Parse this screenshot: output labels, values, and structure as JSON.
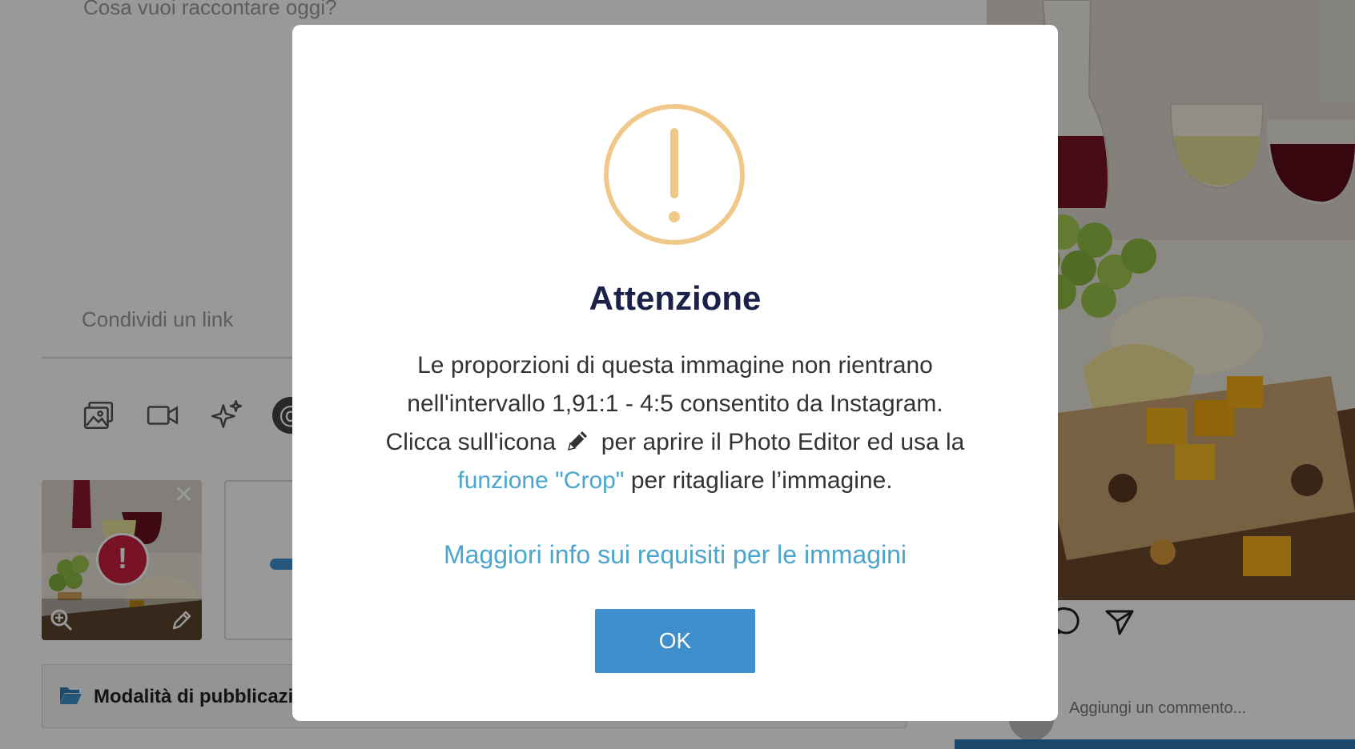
{
  "composer": {
    "post_placeholder": "Cosa vuoi raccontare oggi?",
    "link_placeholder": "Condividi un link",
    "toolbar": {
      "icons": [
        "image-icon",
        "video-icon",
        "sparkles-icon",
        "mention-icon"
      ],
      "mention_glyph": "@"
    },
    "media": {
      "error_glyph": "!",
      "close_glyph": "✕"
    },
    "publish_mode_label": "Modalità di pubblicazione"
  },
  "preview": {
    "comment_placeholder": "Aggiungi un commento..."
  },
  "modal": {
    "title": "Attenzione",
    "body_line1": "Le proporzioni di questa immagine non rientrano",
    "body_line2": "nell'intervallo 1,91:1 - 4:5 consentito da Instagram.",
    "body_line3_before": "Clicca sull'icona",
    "body_line3_after": "per aprire il Photo Editor ed usa la",
    "crop_link": "funzione \"Crop\"",
    "body_line4_after": "per ritagliare l’immagine.",
    "info_link": "Maggiori info sui requisiti per le immagini",
    "ok_label": "OK"
  },
  "colors": {
    "warning": "#f0c98a",
    "title": "#1b2148",
    "link": "#4ba5cc",
    "button": "#3f8fcd",
    "error_badge": "#c8203f"
  }
}
